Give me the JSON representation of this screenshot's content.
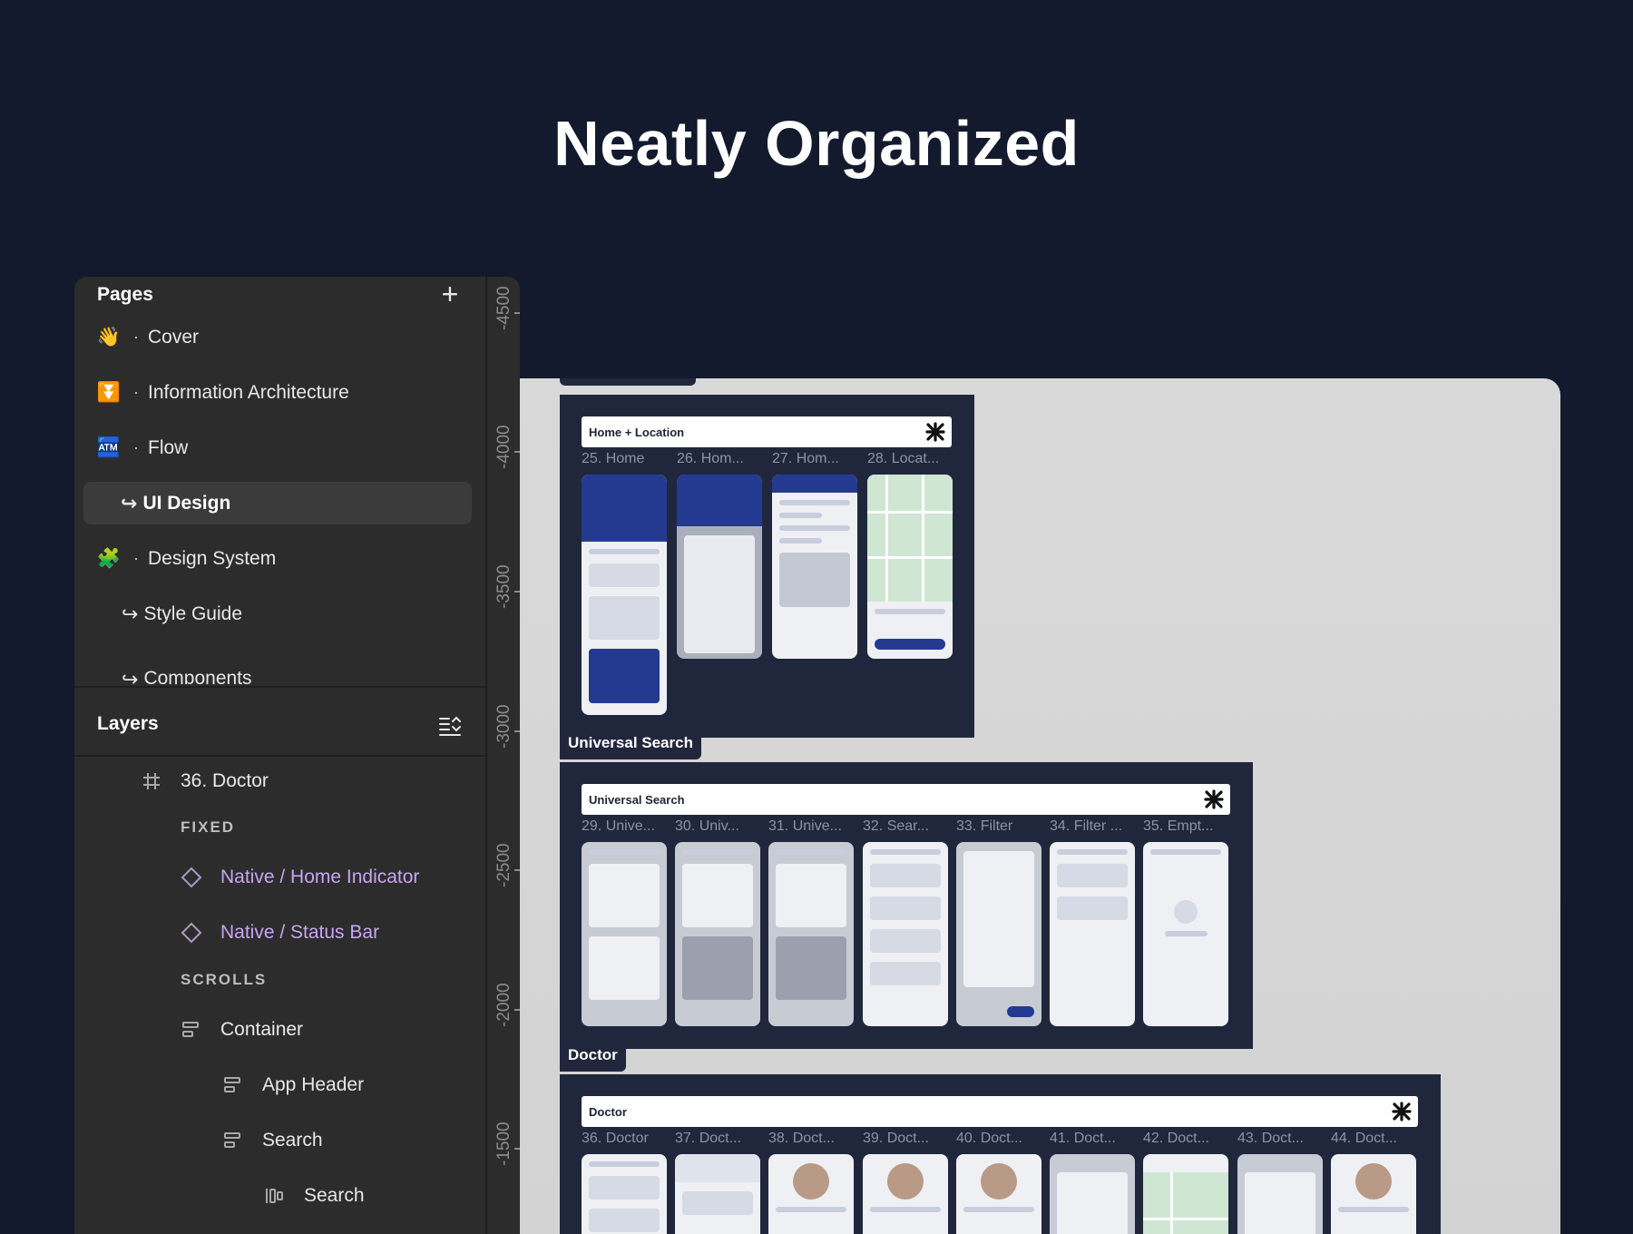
{
  "hero": {
    "title": "Neatly Organized"
  },
  "pages": {
    "heading": "Pages",
    "add_symbol": "+",
    "items": [
      {
        "label": "Cover",
        "emoji": "👋"
      },
      {
        "label": "Information Architecture",
        "emoji": "⏬"
      },
      {
        "label": "Flow",
        "emoji": "🏧"
      },
      {
        "label": "UI Design"
      },
      {
        "label": "Design System",
        "emoji": "🧩"
      },
      {
        "label": "Style Guide"
      },
      {
        "label": "Components"
      }
    ]
  },
  "layers": {
    "heading": "Layers",
    "items": [
      {
        "label": "36. Doctor"
      },
      {
        "label": "FIXED"
      },
      {
        "label": "Native / Home Indicator"
      },
      {
        "label": "Native / Status Bar"
      },
      {
        "label": "SCROLLS"
      },
      {
        "label": "Container"
      },
      {
        "label": "App Header"
      },
      {
        "label": "Search"
      },
      {
        "label": "Search"
      }
    ]
  },
  "ruler": {
    "labels": [
      "-4500",
      "-4000",
      "-3500",
      "-3000",
      "-2500",
      "-2000",
      "-1500"
    ]
  },
  "canvas": {
    "tabs": [
      "Universal Search",
      "Doctor"
    ],
    "groups": [
      {
        "title": "Home + Location",
        "screens": [
          "25. Home",
          "26. Hom...",
          "27. Hom...",
          "28. Locat..."
        ]
      },
      {
        "title": "Universal Search",
        "screens": [
          "29. Unive...",
          "30. Univ...",
          "31. Unive...",
          "32. Sear...",
          "33. Filter",
          "34. Filter ...",
          "35. Empt..."
        ]
      },
      {
        "title": "Doctor",
        "screens": [
          "36. Doctor",
          "37. Doct...",
          "38. Doct...",
          "39. Doct...",
          "40. Doct...",
          "41. Doct...",
          "42. Doct...",
          "43. Doct...",
          "44. Doct..."
        ]
      }
    ],
    "colors": {
      "frame": "#20273d",
      "canvas_bg": "#d9d9d9",
      "brand": "#243a91",
      "accent_purple": "#c7a6f2"
    }
  }
}
